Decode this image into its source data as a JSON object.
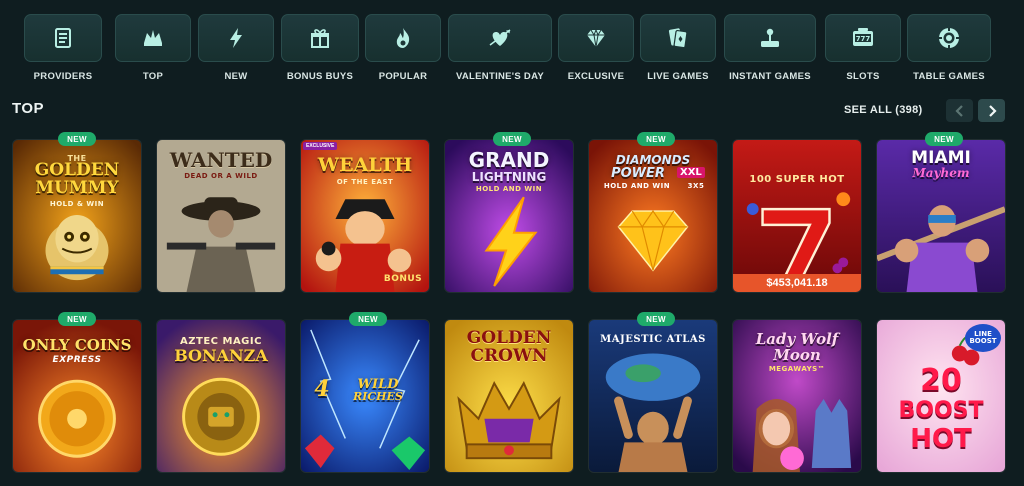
{
  "categories": [
    {
      "label": "PROVIDERS",
      "icon": "providers-icon"
    },
    {
      "label": "TOP",
      "icon": "jester-hat-icon"
    },
    {
      "label": "NEW",
      "icon": "lightning-icon"
    },
    {
      "label": "BONUS BUYS",
      "icon": "gift-icon"
    },
    {
      "label": "POPULAR",
      "icon": "flame-icon"
    },
    {
      "label": "VALENTINE'S DAY",
      "icon": "heart-arrow-icon"
    },
    {
      "label": "EXCLUSIVE",
      "icon": "diamond-icon"
    },
    {
      "label": "LIVE GAMES",
      "icon": "cards-icon"
    },
    {
      "label": "INSTANT GAMES",
      "icon": "joystick-icon"
    },
    {
      "label": "SLOTS",
      "icon": "slot-machine-icon"
    },
    {
      "label": "TABLE GAMES",
      "icon": "casino-chip-icon"
    }
  ],
  "section": {
    "title": "TOP",
    "see_all": "SEE ALL (398)"
  },
  "new_badge": "NEW",
  "games": {
    "golden_mummy": {
      "line1": "THE",
      "line2": "GOLDEN",
      "line3": "MUMMY",
      "sub": "HOLD & WIN"
    },
    "wanted": {
      "title": "WANTED",
      "sub": "DEAD OR A WILD"
    },
    "wealth": {
      "title": "WEALTH",
      "sub": "OF THE EAST",
      "tag": "EXCLUSIVE",
      "bonus": "BONUS"
    },
    "grand_lightning": {
      "line1": "GRAND",
      "line2": "LIGHTNING",
      "sub": "HOLD AND WIN"
    },
    "diamonds_power": {
      "line1": "DIAMONDS",
      "line2": "POWER",
      "xxl": "XXL",
      "sub": "HOLD AND WIN",
      "ways": "3X5"
    },
    "super_hot": {
      "title": "100 SUPER HOT",
      "jackpot": "$453,041.18"
    },
    "miami_mayhem": {
      "line1": "MIAMI",
      "line2": "Mayhem"
    },
    "only_coins": {
      "line1": "ONLY COINS",
      "line2": "EXPRESS"
    },
    "aztec": {
      "line1": "AZTEC MAGIC",
      "line2": "BONANZA"
    },
    "wild_riches": {
      "num": "4",
      "line1": "WILD",
      "line2": "RICHES"
    },
    "golden_crown": {
      "line1": "GOLDEN",
      "line2": "CROWN"
    },
    "majestic_atlas": {
      "title": "MAJESTIC ATLAS"
    },
    "lady_wolf": {
      "line1": "Lady Wolf",
      "line2": "Moon",
      "sub": "MEGAWAYS™"
    },
    "boost_hot": {
      "line1": "20",
      "line2": "BOOST",
      "line3": "HOT",
      "tag": "LINE BOOST"
    }
  }
}
